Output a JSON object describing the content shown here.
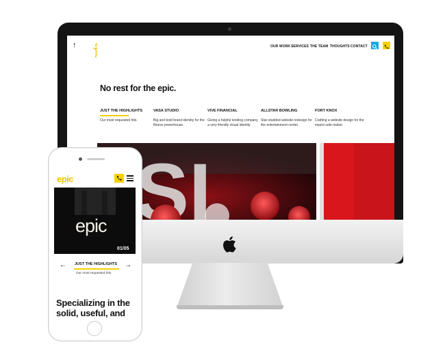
{
  "desktop": {
    "logo_text": "epic",
    "nav": [
      "OUR WORK",
      "SERVICES",
      "THE TEAM",
      "THOUGHTS",
      "CONTACT"
    ],
    "headline": "No rest for the epic.",
    "columns": [
      {
        "title": "JUST THE HIGHLIGHTS",
        "text": "Our most requested hits.",
        "active": true
      },
      {
        "title": "VASA STUDIO",
        "text": "Big and bold brand identity for the fitness powerhouse.",
        "active": false
      },
      {
        "title": "VIVE FINANCIAL",
        "text": "Giving a helpful lending company a very friendly visual identity.",
        "active": false
      },
      {
        "title": "ALLSTAR BOWLING",
        "text": "Star-studded website redesign for the entertainment center.",
        "active": false
      },
      {
        "title": "FORT KNOX",
        "text": "Crafting a website design for the expert safe maker.",
        "active": false
      }
    ]
  },
  "mobile": {
    "logo_text": "epic",
    "hero_word": "epic",
    "counter": "01/05",
    "slide_title": "JUST THE HIGHLIGHTS",
    "slide_text": "Our most requested hits.",
    "big_text": "Specializing in the solid, useful, and"
  },
  "colors": {
    "accent_yellow": "#f5d000",
    "search_blue": "#19a7e0",
    "hero_red": "#d9161c"
  },
  "icons": [
    "up-arrow-icon",
    "search-icon",
    "phone-icon",
    "menu-icon",
    "chevron-left-icon",
    "chevron-right-icon",
    "apple-logo-icon"
  ]
}
